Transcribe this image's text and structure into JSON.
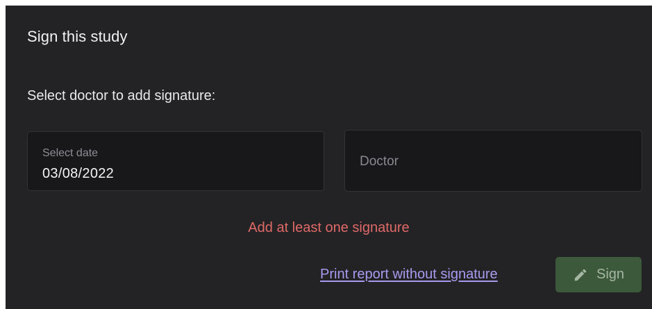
{
  "dialog": {
    "title": "Sign this study",
    "prompt": "Select doctor to add signature:"
  },
  "date_field": {
    "label": "Select date",
    "value": "03/08/2022"
  },
  "doctor_field": {
    "placeholder": "Doctor"
  },
  "error_message": "Add at least one signature",
  "actions": {
    "print_link": "Print report without signature",
    "sign_button": "Sign",
    "sign_icon": "pencil-icon"
  },
  "colors": {
    "background": "#232225",
    "field_background": "#18171a",
    "error": "#e06a67",
    "link": "#a99af0",
    "sign_button": "#3c5a3b"
  }
}
